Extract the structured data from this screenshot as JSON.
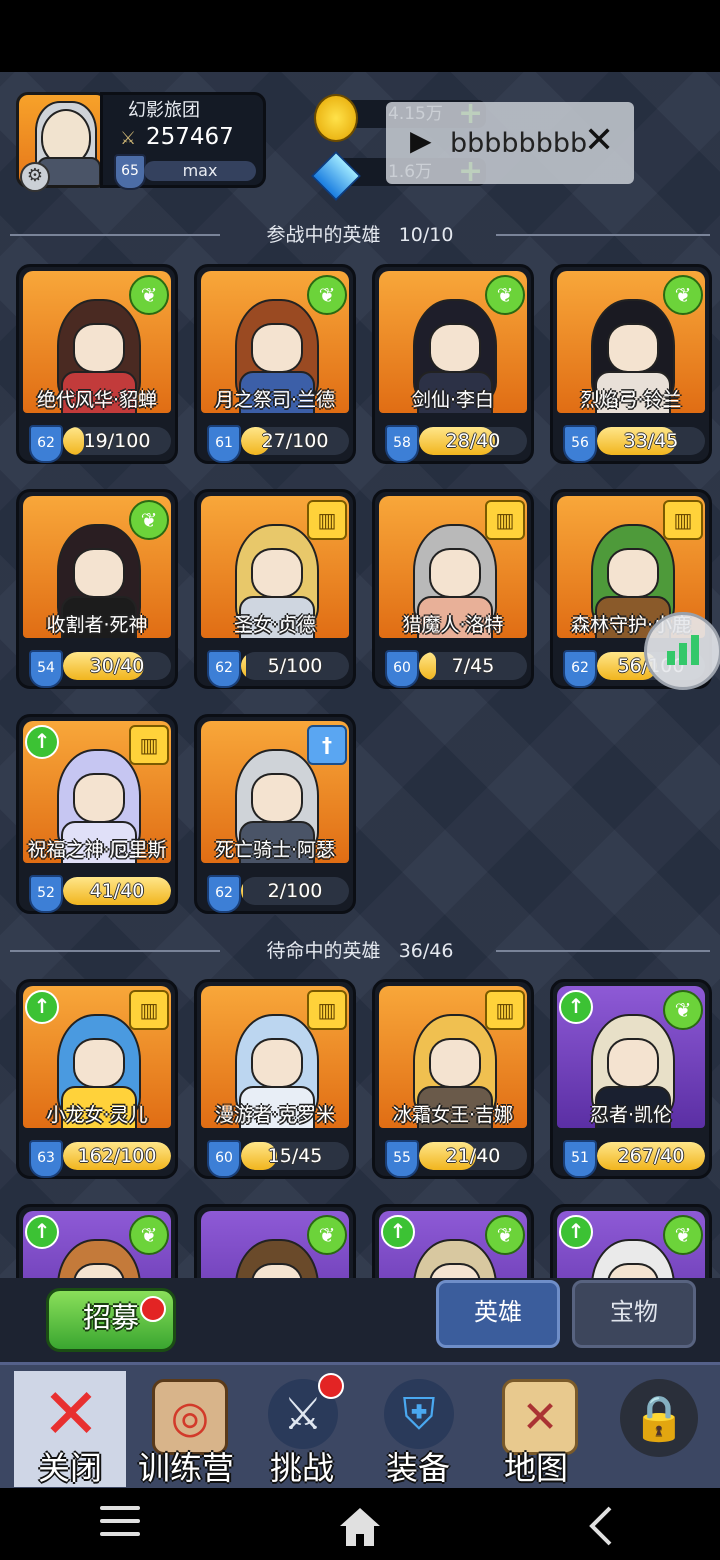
{
  "header": {
    "guild_name": "幻影旅团",
    "power": "257467",
    "level": "65",
    "xp_label": "max",
    "gold": "4.15万",
    "gems": "1.6万"
  },
  "ad": {
    "text": "bbbbbbbb"
  },
  "active_section": {
    "title": "参战中的英雄",
    "count": "10/10"
  },
  "standby_section": {
    "title": "待命中的英雄",
    "count": "36/46"
  },
  "active_heroes": [
    {
      "name": "绝代风华·貂蝉",
      "level": "62",
      "progress": "19/100",
      "fill": 0.19,
      "badge": "wing",
      "badge_icon": "wing-icon",
      "upgrade": false,
      "hair": "#4a2a22",
      "body": "#c23b3b"
    },
    {
      "name": "月之祭司·兰德",
      "level": "61",
      "progress": "27/100",
      "fill": 0.27,
      "badge": "wing",
      "badge_icon": "wing-icon",
      "upgrade": false,
      "hair": "#9a4a22",
      "body": "#3c5fa8"
    },
    {
      "name": "剑仙·李白",
      "level": "58",
      "progress": "28/40",
      "fill": 0.7,
      "badge": "wing",
      "badge_icon": "wing-icon",
      "upgrade": false,
      "hair": "#1e1e2a",
      "body": "#2c3146"
    },
    {
      "name": "烈焰弓·铃兰",
      "level": "56",
      "progress": "33/45",
      "fill": 0.73,
      "badge": "wing",
      "badge_icon": "wing-icon",
      "upgrade": false,
      "hair": "#1a1a22",
      "body": "#e8e0d8"
    },
    {
      "name": "收割者·死神",
      "level": "54",
      "progress": "30/40",
      "fill": 0.75,
      "badge": "wing",
      "badge_icon": "wing-icon",
      "upgrade": false,
      "hair": "#2a1e22",
      "body": "#1c1c1c"
    },
    {
      "name": "圣女·贞德",
      "level": "62",
      "progress": "5/100",
      "fill": 0.05,
      "badge": "book",
      "badge_icon": "book-icon",
      "upgrade": false,
      "hair": "#e8c86a",
      "body": "#cfd6e0"
    },
    {
      "name": "猎魔人·洛特",
      "level": "60",
      "progress": "7/45",
      "fill": 0.16,
      "badge": "book",
      "badge_icon": "book-icon",
      "upgrade": false,
      "hair": "#b9b9b9",
      "body": "#e8b098"
    },
    {
      "name": "森林守护·小鹿",
      "level": "62",
      "progress": "56/100",
      "fill": 0.56,
      "badge": "book",
      "badge_icon": "book-icon",
      "upgrade": false,
      "hair": "#4e9a3a",
      "body": "#8a5a2a"
    },
    {
      "name": "祝福之神·厄里斯",
      "level": "52",
      "progress": "41/40",
      "fill": 1.0,
      "badge": "book",
      "badge_icon": "book-icon",
      "upgrade": true,
      "hair": "#c6c6f2",
      "body": "#e0e0f8"
    },
    {
      "name": "死亡骑士·阿瑟",
      "level": "62",
      "progress": "2/100",
      "fill": 0.02,
      "badge": "sword",
      "badge_icon": "sword-icon",
      "upgrade": false,
      "hair": "#cfd3d8",
      "body": "#4a5467"
    }
  ],
  "standby_heroes": [
    {
      "name": "小龙女·灵儿",
      "level": "63",
      "progress": "162/100",
      "fill": 1.0,
      "badge": "book",
      "badge_icon": "book-icon",
      "upgrade": true,
      "purple": false,
      "hair": "#4a9ae0",
      "body": "#ffd23a"
    },
    {
      "name": "漫游者·克罗米",
      "level": "60",
      "progress": "15/45",
      "fill": 0.33,
      "badge": "book",
      "badge_icon": "book-icon",
      "upgrade": false,
      "purple": false,
      "hair": "#bcd6f0",
      "body": "#e8eef6"
    },
    {
      "name": "冰霜女王·吉娜",
      "level": "55",
      "progress": "21/40",
      "fill": 0.53,
      "badge": "book",
      "badge_icon": "book-icon",
      "upgrade": false,
      "purple": false,
      "hair": "#f0c050",
      "body": "#6a5a4a"
    },
    {
      "name": "忍者·凯伦",
      "level": "51",
      "progress": "267/40",
      "fill": 1.0,
      "badge": "wing",
      "badge_icon": "wing-icon",
      "upgrade": true,
      "purple": true,
      "hair": "#e8e0c8",
      "body": "#1a2030"
    }
  ],
  "partial_heroes": [
    {
      "badge": "wing",
      "badge_icon": "wing-icon",
      "upgrade": true,
      "hair": "#c47a3a"
    },
    {
      "badge": "wing",
      "badge_icon": "wing-icon",
      "upgrade": false,
      "hair": "#6a4a2a"
    },
    {
      "badge": "wing",
      "badge_icon": "wing-icon",
      "upgrade": true,
      "hair": "#d8c8a0"
    },
    {
      "badge": "wing",
      "badge_icon": "wing-icon",
      "upgrade": true,
      "hair": "#eaeaea"
    }
  ],
  "buttons": {
    "recruit": "招募"
  },
  "tabs": {
    "heroes": "英雄",
    "treasure": "宝物"
  },
  "nav": {
    "close": "关闭",
    "training": "训练营",
    "challenge": "挑战",
    "equipment": "装备",
    "map": "地图"
  }
}
